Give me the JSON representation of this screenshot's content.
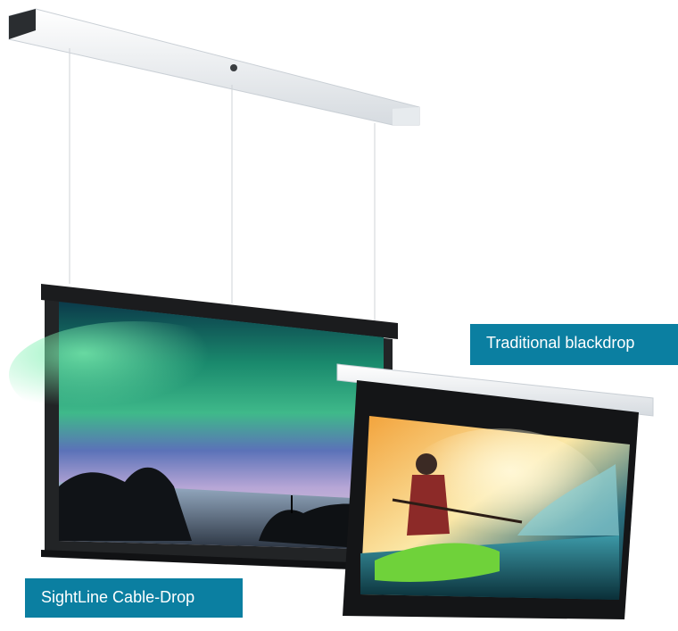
{
  "labels": {
    "traditional": "Traditional blackdrop",
    "sightline": "SightLine Cable-Drop"
  },
  "colors": {
    "label_bg": "#0b7fa1",
    "housing": "#f1f3f5",
    "case_black": "#18191b"
  }
}
